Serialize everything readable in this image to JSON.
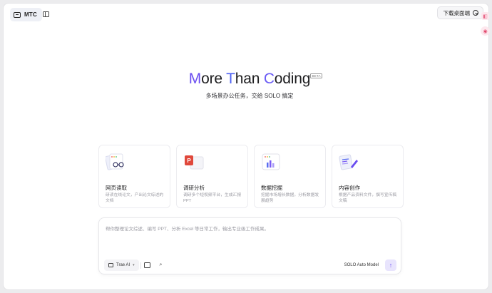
{
  "header": {
    "brand_label": "MTC",
    "download_label": "下载桌面端"
  },
  "hero": {
    "title_parts": [
      "M",
      "ore ",
      "T",
      "han ",
      "C",
      "oding"
    ],
    "beta_badge": "BETA",
    "subtitle": "多场景办公任务，交给 SOLO 搞定"
  },
  "cards": [
    {
      "title": "网页读取",
      "desc": "研读在线论文，产出论文综述的文档",
      "icon": "web-reading-icon"
    },
    {
      "title": "调研分析",
      "desc": "调研多个短视频平台，生成汇报 PPT",
      "icon": "ppt-icon"
    },
    {
      "title": "数据挖掘",
      "desc": "挖掘市场增长数据，分析数据发展趋势",
      "icon": "bar-chart-icon"
    },
    {
      "title": "内容创作",
      "desc": "根据产品资料文件，撰写宣传稿文稿",
      "icon": "writing-icon"
    }
  ],
  "composer": {
    "placeholder": "帮你整理论文综述、编写 PPT、分析 Excel 等日常工作，输出专业级工作成果。",
    "model_label": "Trae AI",
    "solo_label": "SOLO Auto Model"
  },
  "colors": {
    "accent": "#6a4df0",
    "accent_blue": "#4f63f3",
    "send_bg": "#e8e4fd"
  }
}
